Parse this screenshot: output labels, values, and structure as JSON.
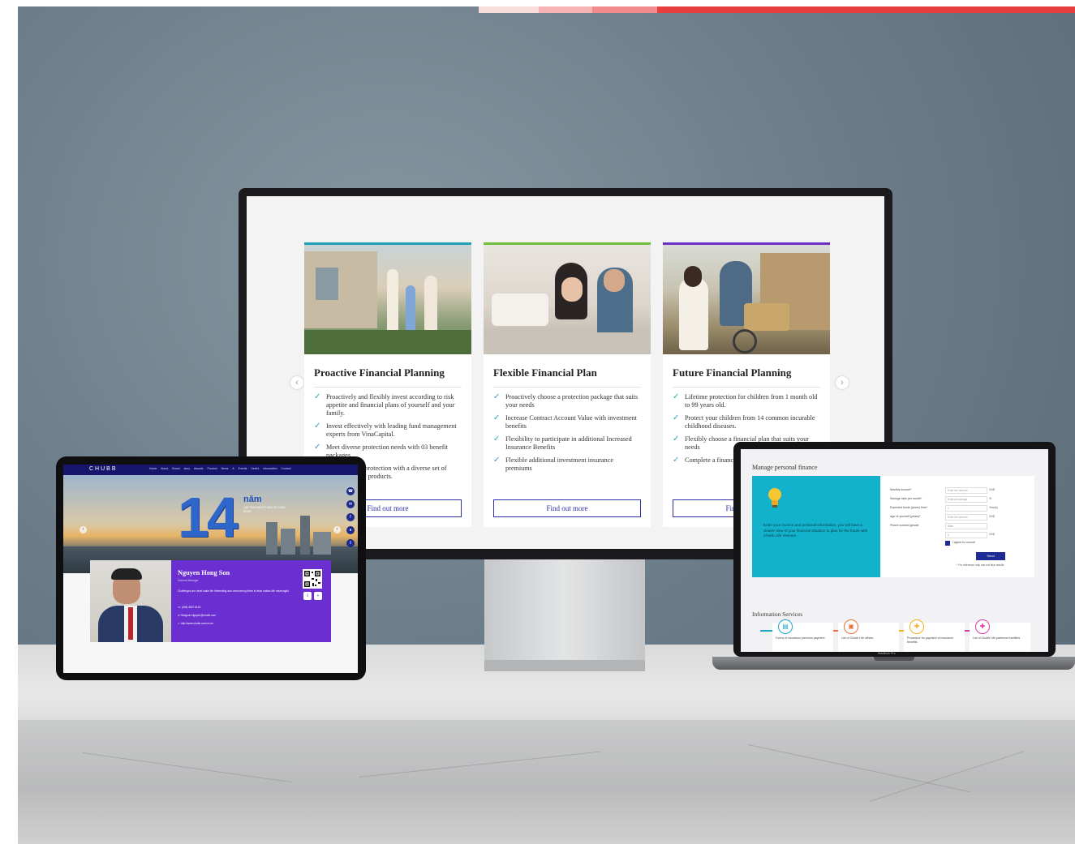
{
  "monitor": {
    "cards": [
      {
        "title": "Proactive Financial Planning",
        "bullets": [
          "Proactively and flexibly invest according to risk appetite and financial plans of yourself and your family.",
          "Invest effectively with leading fund management experts from VinaCapital.",
          "Meet diverse protection needs with 03 benefit packages",
          "Enhance your protection with a diverse set of Supplementary products."
        ],
        "button": "Find out more"
      },
      {
        "title": "Flexible Financial Plan",
        "bullets": [
          "Proactively choose a protection package that suits your needs",
          "Increase Contract Account Value with investment benefits",
          "Flexibility to participate in additional Increased Insurance Benefits",
          "Flexible additional investment insurance premiums"
        ],
        "button": "Find out more"
      },
      {
        "title": "Future Financial Planning",
        "bullets": [
          "Lifetime protection for children from 1 month old to 99 years old.",
          "Protect your children from 14 common incurable childhood diseases.",
          "Flexibly choose a financial plan that suits your needs",
          "Complete a financial plan when risks occur."
        ],
        "button": "Find out more"
      }
    ],
    "prev_arrow": "‹",
    "next_arrow": "›"
  },
  "laptop": {
    "title": "Manage personal finance",
    "promo_text": "Enter your income and personal information, you will have a clearer view of your financial situation to plan for the future with Chubb Life Vietnam",
    "form_rows": [
      {
        "label": "Monthly income*",
        "placeholder": "Enter the amount",
        "unit": "VND"
      },
      {
        "label": "Savings ratio per month*",
        "placeholder": "Enter percentage",
        "unit": "%"
      },
      {
        "label": "Expected funds (years) time*",
        "placeholder": "1",
        "unit": "Year(s)"
      },
      {
        "label": "Age of yourself (years)*",
        "placeholder": "Enter the amount",
        "unit": "VND"
      },
      {
        "label": "Phone number/gender",
        "placeholder": "Male",
        "unit": ""
      },
      {
        "label": "",
        "placeholder": "0",
        "unit": "VND"
      }
    ],
    "checkbox_label": "I agree to consult",
    "send_button": "Send",
    "note": "* For reference only and not final results",
    "info_title": "Information Services",
    "services": [
      {
        "icon": "document-icon",
        "glyph": "▤",
        "text": "Forms of insurance premium payment",
        "color": "#1aa5c9"
      },
      {
        "icon": "building-icon",
        "glyph": "▣",
        "text": "List of Chubb Life offices",
        "color": "#e9713b"
      },
      {
        "icon": "hospital-icon",
        "glyph": "✚",
        "text": "Procedure for payment of insurance benefits",
        "color": "#f2b21a"
      },
      {
        "icon": "hospital-icon",
        "glyph": "✚",
        "text": "List of Chubb Life partnered facilities",
        "color": "#d63aa8"
      }
    ],
    "brand": "MacBook Pro"
  },
  "tablet": {
    "logo": "CHUBB",
    "nav_items": [
      "Home",
      "About",
      "Brand story",
      "Awards",
      "Product",
      "News & Events",
      "Useful information",
      "Contact"
    ],
    "hero_number": "14",
    "hero_word": "năm",
    "hero_sub": "LAN TỎA CAM KẾT BẢO VỆ CỘNG ĐỒNG",
    "profile_name": "Nguyen Hong Son",
    "profile_role": "General Manager",
    "profile_quote": "Challenges are what make life interesting and overcoming them is what makes life meaningful",
    "profile_lines": [
      "(028) 3827 8123",
      "Hongson.Nguyen@chubb.com",
      "http://www.chubb.com/vn-en"
    ]
  },
  "colors": {
    "accent_bar": [
      "#f9dcdc",
      "#f6b3b3",
      "#f28b8b",
      "#e83e3e"
    ],
    "chubb_navy": "#16166d",
    "purple": "#6b2fd1",
    "cyan": "#12b1cc",
    "button_blue": "#2b2ea8"
  }
}
